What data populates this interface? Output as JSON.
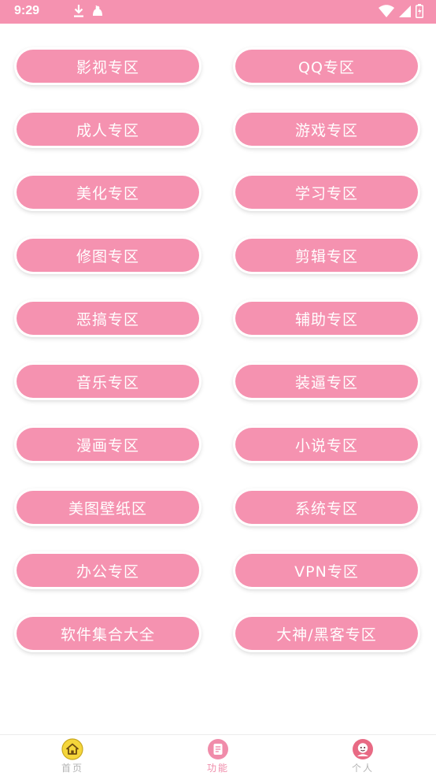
{
  "status_bar": {
    "time": "9:29",
    "background": "#f592b0"
  },
  "grid": {
    "buttons": [
      {
        "label": "影视专区"
      },
      {
        "label": "QQ专区"
      },
      {
        "label": "成人专区"
      },
      {
        "label": "游戏专区"
      },
      {
        "label": "美化专区"
      },
      {
        "label": "学习专区"
      },
      {
        "label": "修图专区"
      },
      {
        "label": "剪辑专区"
      },
      {
        "label": "恶搞专区"
      },
      {
        "label": "辅助专区"
      },
      {
        "label": "音乐专区"
      },
      {
        "label": "装逼专区"
      },
      {
        "label": "漫画专区"
      },
      {
        "label": "小说专区"
      },
      {
        "label": "美图壁纸区"
      },
      {
        "label": "系统专区"
      },
      {
        "label": "办公专区"
      },
      {
        "label": "VPN专区"
      },
      {
        "label": "软件集合大全"
      },
      {
        "label": "大神/黑客专区"
      }
    ],
    "button_color": "#f592b0"
  },
  "bottom_nav": {
    "items": [
      {
        "label": "首页",
        "icon": "home-icon",
        "active": false
      },
      {
        "label": "功能",
        "icon": "document-icon",
        "active": true
      },
      {
        "label": "个人",
        "icon": "profile-icon",
        "active": false
      }
    ],
    "active_color": "#f08caa",
    "inactive_color": "#b5b5b5"
  }
}
